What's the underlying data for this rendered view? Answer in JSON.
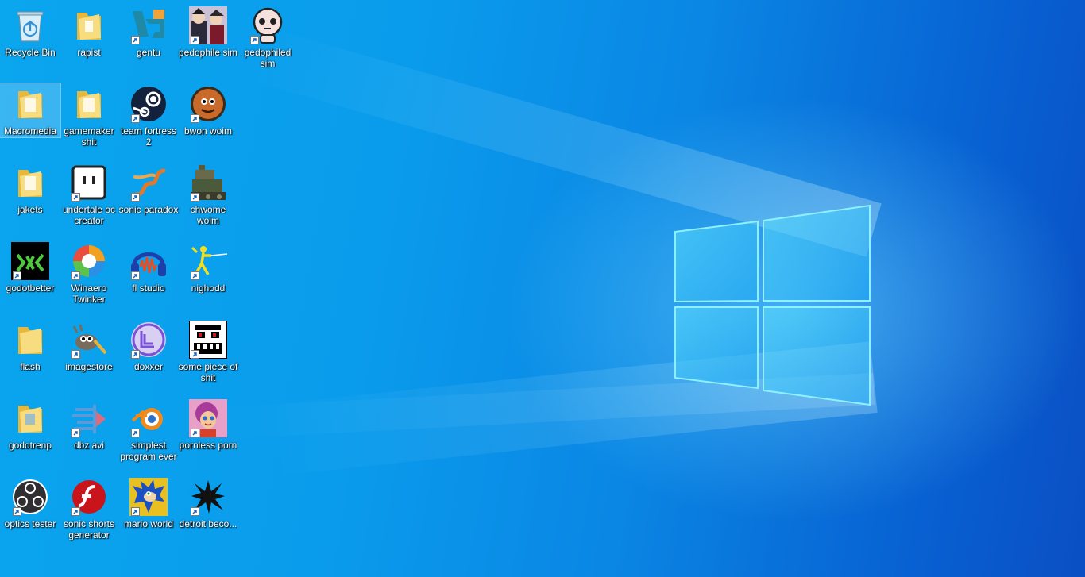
{
  "desktop": {
    "icons": [
      {
        "label": "Recycle Bin",
        "icon": "recycle-bin-icon"
      },
      {
        "label": "rapist",
        "icon": "folder-icon"
      },
      {
        "label": "gentu",
        "icon": "gentu-app-icon"
      },
      {
        "label": "pedophile sim",
        "icon": "pedophile-sim-app-icon"
      },
      {
        "label": "pedophiled sim",
        "icon": "pedophiled-sim-app-icon"
      },
      {
        "label": "Macromedia",
        "icon": "folder-icon"
      },
      {
        "label": "gamemaker shit",
        "icon": "folder-icon"
      },
      {
        "label": "team fortress 2",
        "icon": "steam-icon"
      },
      {
        "label": "bwon woim",
        "icon": "bwon-woim-app-icon"
      },
      {
        "label": "jakets",
        "icon": "folder-icon"
      },
      {
        "label": "undertale oc creator",
        "icon": "undertale-oc-creator-icon"
      },
      {
        "label": "sonic paradox",
        "icon": "sonic-paradox-icon"
      },
      {
        "label": "chwome woim",
        "icon": "chwome-woim-icon"
      },
      {
        "label": "godotbetter",
        "icon": "godot-icon"
      },
      {
        "label": "Winaero Twinker",
        "icon": "winaero-tweaker-icon"
      },
      {
        "label": "fl studio",
        "icon": "audacity-icon"
      },
      {
        "label": "nighodd",
        "icon": "fencer-icon"
      },
      {
        "label": "flash",
        "icon": "folder-icon"
      },
      {
        "label": "imagestore",
        "icon": "gimp-icon"
      },
      {
        "label": "doxxer",
        "icon": "bittorrent-icon"
      },
      {
        "label": "some piece of shit",
        "icon": "pixel-face-icon"
      },
      {
        "label": "godotrenp",
        "icon": "folder-icon"
      },
      {
        "label": "dbz avi",
        "icon": "dbz-avi-icon"
      },
      {
        "label": "simplest program ever",
        "icon": "blender-icon"
      },
      {
        "label": "pornless porn",
        "icon": "cartoon-girl-icon"
      },
      {
        "label": "optics tester",
        "icon": "obs-icon"
      },
      {
        "label": "sonic shorts generator",
        "icon": "flash-player-icon"
      },
      {
        "label": "mario world",
        "icon": "sonic-icon"
      },
      {
        "label": "detroit beco...",
        "icon": "splat-icon"
      }
    ]
  },
  "colors": {
    "wallpaper_light": "#0aa6ee",
    "wallpaper_dark": "#0a4fc4",
    "logo": "#4fd8ff"
  }
}
